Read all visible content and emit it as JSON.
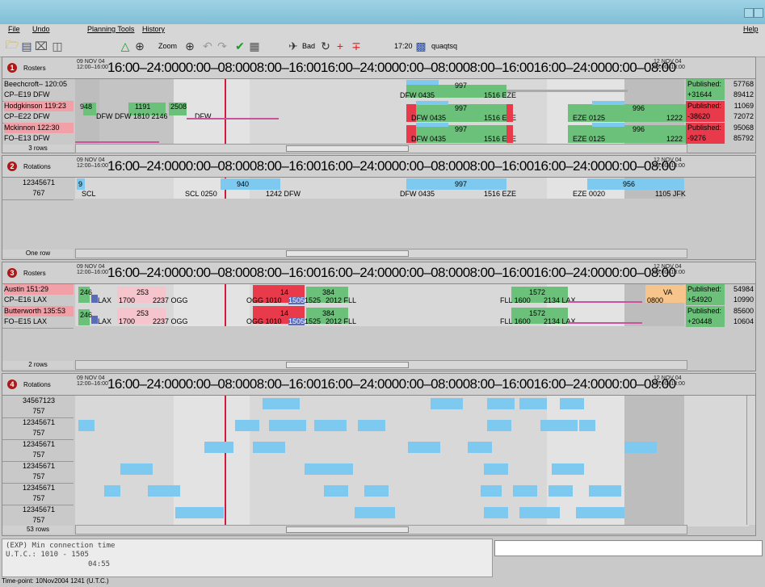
{
  "menu": {
    "file": "File",
    "undo": "Undo",
    "planning": "Planning Tools",
    "history": "History",
    "help": "Help"
  },
  "toolbar": {
    "zoom": "Zoom",
    "bad": "Bad",
    "time": "17:20",
    "user": "quaqtsq"
  },
  "timeline": "16:00–24:0000:00–08:0008:00–16:0016:00–24:0000:00–08:0008:00–16:0016:00–24:0000:00–08:00",
  "date_start": {
    "date": "09 NOV 04",
    "range": "12:00–16:00"
  },
  "date_end": {
    "date": "12 NOV 04",
    "range": "08:00–13:00"
  },
  "panels": [
    {
      "num": "1",
      "label": "Rosters",
      "footer": "3 rows",
      "rows": [
        {
          "l1": "Beechcroft– 120:05",
          "l2": "CP–E19   DFW",
          "pub": "Published:",
          "v1": "57768",
          "p2": "+31644",
          "v2": "89412",
          "warn": false
        },
        {
          "l1": "Hodgkinson 119:23",
          "l2": "CP–E22   DFW",
          "pub": "Published:",
          "v1": "11069",
          "p2": "-38620",
          "v2": "72072",
          "warn": true
        },
        {
          "l1": "Mckinnon   122:30",
          "l2": "FO–E13   DFW",
          "pub": "Published:",
          "v1": "95068",
          "p2": "-9276",
          "v2": "85792",
          "warn": true
        }
      ],
      "texts": [
        "997",
        "DFW 0435",
        "1516 EZE",
        "948",
        "1191",
        "2508",
        "DFW DFW 1810 2146",
        "DFW",
        "997",
        "DFW 0435",
        "1516 EZE",
        "996",
        "EZE 0125",
        "1222",
        "997",
        "DFW 0435",
        "1516 EZE",
        "996",
        "EZE 0125",
        "1222"
      ]
    },
    {
      "num": "2",
      "label": "Rotations",
      "footer": "One row",
      "rows": [
        {
          "l1": "12345671",
          "l2": "767"
        }
      ],
      "texts": [
        "9",
        "SCL",
        "940",
        "SCL 0250",
        "1242 DFW",
        "997",
        "DFW 0435",
        "1516 EZE",
        "956",
        "EZE 0020",
        "1105 JFK"
      ]
    },
    {
      "num": "3",
      "label": "Rosters",
      "footer": "2 rows",
      "rows": [
        {
          "l1": "Austin       151:29",
          "l2": "CP–E16   LAX",
          "pub": "Published:",
          "v1": "54984",
          "p2": "+54920",
          "v2": "10990",
          "warn": true
        },
        {
          "l1": "Butterworth 135:53",
          "l2": "FO–E15   LAX",
          "pub": "Published:",
          "v1": "85600",
          "p2": "+20448",
          "v2": "10604",
          "warn": true
        }
      ],
      "texts": [
        "246",
        "LAX",
        "253",
        "1700",
        "2237 OGG",
        "14",
        "OGG 1010",
        "1505",
        "1525",
        "384",
        "2012 FLL",
        "1572",
        "FLL 1600",
        "2134 LAX",
        "VA",
        "0800"
      ]
    },
    {
      "num": "4",
      "label": "Rotations",
      "footer": "53 rows",
      "rows": [
        {
          "l1": "34567123",
          "l2": "757"
        },
        {
          "l1": "12345671",
          "l2": "757"
        },
        {
          "l1": "12345671",
          "l2": "757"
        },
        {
          "l1": "12345671",
          "l2": "757"
        },
        {
          "l1": "12345671",
          "l2": "757"
        },
        {
          "l1": "12345671",
          "l2": "757"
        }
      ]
    }
  ],
  "info": {
    "line1": "(EXP) Min connection time",
    "line2": "U.T.C.: 1010 - 1505",
    "line3": "04:55"
  },
  "status": "Time-point: 10Nov2004 1241 (U.T.C.)",
  "colors": {
    "green": "#6cc17a",
    "blue": "#7ec9ef",
    "red": "#e83a4a",
    "pink": "#f6c4cd",
    "orange": "#f7c48c",
    "title": "#7fbfd6"
  }
}
